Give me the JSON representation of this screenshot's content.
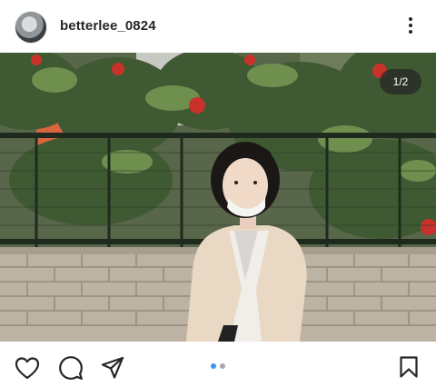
{
  "post": {
    "username": "betterlee_0824",
    "media_counter": "1/2"
  },
  "carousel": {
    "total": 2,
    "active_index": 1,
    "active_color": "#3897f0",
    "inactive_color": "#a8a8a8"
  },
  "icons": {
    "like": "heart-icon",
    "comment": "comment-icon",
    "share": "paper-plane-icon",
    "save": "bookmark-icon",
    "more": "three-dots-vertical-icon"
  }
}
